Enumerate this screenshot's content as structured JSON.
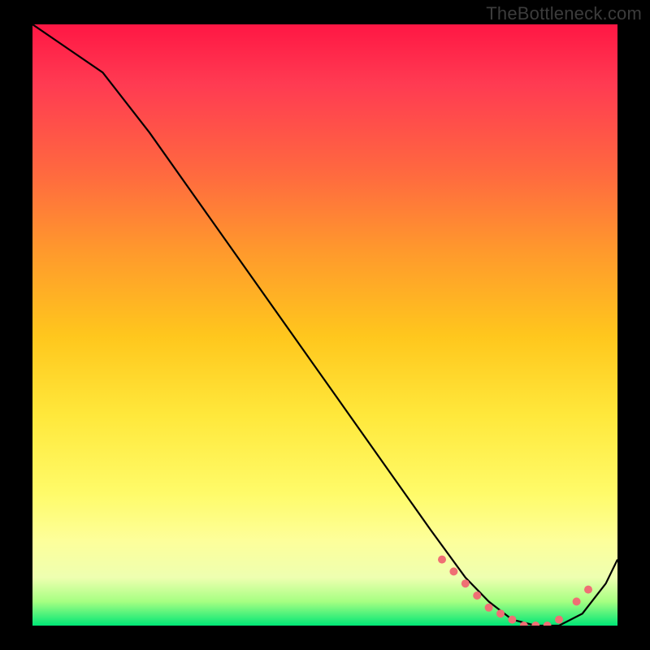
{
  "watermark": "TheBottleneck.com",
  "chart_data": {
    "type": "line",
    "title": "",
    "xlabel": "",
    "ylabel": "",
    "xlim": [
      0,
      100
    ],
    "ylim": [
      0,
      100
    ],
    "x": [
      0,
      6,
      12,
      20,
      28,
      36,
      44,
      52,
      60,
      68,
      74,
      78,
      82,
      86,
      90,
      94,
      98,
      100
    ],
    "y": [
      100,
      96,
      92,
      82,
      71,
      60,
      49,
      38,
      27,
      16,
      8,
      4,
      1,
      0,
      0,
      2,
      7,
      11
    ],
    "marker_points": {
      "x": [
        70,
        72,
        74,
        76,
        78,
        80,
        82,
        84,
        86,
        88,
        90,
        93,
        95
      ],
      "y": [
        11,
        9,
        7,
        5,
        3,
        2,
        1,
        0,
        0,
        0,
        1,
        4,
        6
      ]
    },
    "gradient_stops": [
      {
        "pos": 0,
        "color": "#ff1744"
      },
      {
        "pos": 10,
        "color": "#ff3b52"
      },
      {
        "pos": 25,
        "color": "#ff6a3f"
      },
      {
        "pos": 38,
        "color": "#ff9a2c"
      },
      {
        "pos": 52,
        "color": "#ffc71d"
      },
      {
        "pos": 65,
        "color": "#ffe83b"
      },
      {
        "pos": 78,
        "color": "#fffb69"
      },
      {
        "pos": 86,
        "color": "#fdff9b"
      },
      {
        "pos": 92,
        "color": "#eeffb0"
      },
      {
        "pos": 96,
        "color": "#a6ff82"
      },
      {
        "pos": 100,
        "color": "#00e676"
      }
    ],
    "line_color": "#000000",
    "marker_color": "#ef6f74"
  }
}
